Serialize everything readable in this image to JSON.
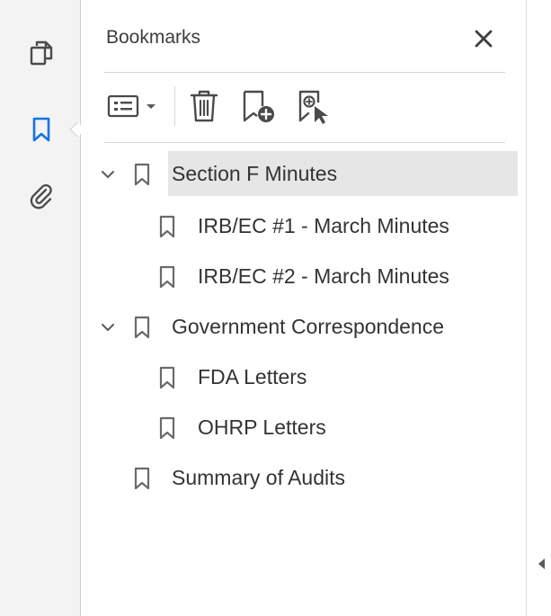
{
  "panel": {
    "title": "Bookmarks"
  },
  "colors": {
    "accent": "#1473e6",
    "icon": "#4b4b4b",
    "selected_bg": "#e6e6e6",
    "rail_bg": "#f3f3f3"
  },
  "rail": {
    "items": [
      {
        "icon": "pages-icon",
        "active": false
      },
      {
        "icon": "bookmark-icon",
        "active": true
      },
      {
        "icon": "attachment-icon",
        "active": false
      }
    ]
  },
  "toolbar": {
    "buttons": [
      {
        "icon": "options-menu-icon"
      },
      {
        "icon": "trash-icon"
      },
      {
        "icon": "new-bookmark-icon"
      },
      {
        "icon": "find-current-bookmark-icon"
      }
    ]
  },
  "bookmarks": [
    {
      "label": "Section F Minutes",
      "level": 0,
      "expanded": true,
      "selected": true
    },
    {
      "label": "IRB/EC #1 - March Minutes",
      "level": 1
    },
    {
      "label": "IRB/EC #2 - March Minutes",
      "level": 1
    },
    {
      "label": "Government Correspondence",
      "level": 0,
      "expanded": true
    },
    {
      "label": "FDA Letters",
      "level": 1
    },
    {
      "label": "OHRP Letters",
      "level": 1
    },
    {
      "label": "Summary of Audits",
      "level": 0
    }
  ]
}
